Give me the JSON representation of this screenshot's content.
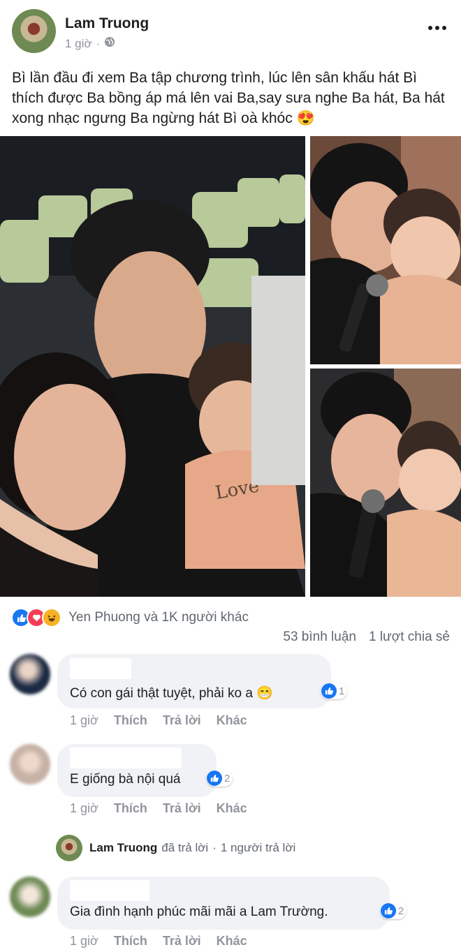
{
  "post": {
    "author": "Lam Truong",
    "time": "1 giờ",
    "separator": "·",
    "privacy_icon": "globe-icon",
    "more_icon": "more-horizontal-icon",
    "text": "Bì lần đầu đi xem Ba tập chương trình, lúc lên sân khấu hát Bì thích được Ba bồng áp má lên vai Ba,say sưa nghe Ba hát, Ba hát xong nhạc ngưng Ba ngừng hát Bì oà khóc",
    "text_emoji": "😍",
    "photos": [
      {
        "description": "family-selfie"
      },
      {
        "description": "father-kissing-daughter"
      },
      {
        "description": "father-holding-microphone-with-daughter"
      }
    ]
  },
  "reactions": {
    "icons": [
      "like-icon",
      "love-icon",
      "haha-icon"
    ],
    "summary": "Yen Phuong và 1K người khác",
    "comments_count": "53 bình luận",
    "shares_count": "1 lượt chia sẻ"
  },
  "comments": [
    {
      "text": "Có con gái thật tuyệt, phải ko a",
      "emoji": "😁",
      "likes": "1",
      "time": "1 giờ",
      "like_label": "Thích",
      "reply_label": "Trả lời",
      "more_label": "Khác"
    },
    {
      "text": "E giống bà nội quá",
      "emoji": "",
      "likes": "2",
      "time": "1 giờ",
      "like_label": "Thích",
      "reply_label": "Trả lời",
      "more_label": "Khác"
    },
    {
      "text": "Gia đình hạnh phúc mãi mãi a Lam Trường.",
      "emoji": "",
      "likes": "2",
      "time": "1 giờ",
      "like_label": "Thích",
      "reply_label": "Trả lời",
      "more_label": "Khác"
    }
  ],
  "reply_summary": {
    "name": "Lam Truong",
    "action": "đã trả lời",
    "separator": "·",
    "count": "1 người trả lời"
  },
  "colors": {
    "brand_blue": "#1877f2",
    "love_red": "#f33e58",
    "haha_yellow": "#f7b125",
    "bubble_gray": "#f0f2f5",
    "meta_gray": "#90949c"
  }
}
